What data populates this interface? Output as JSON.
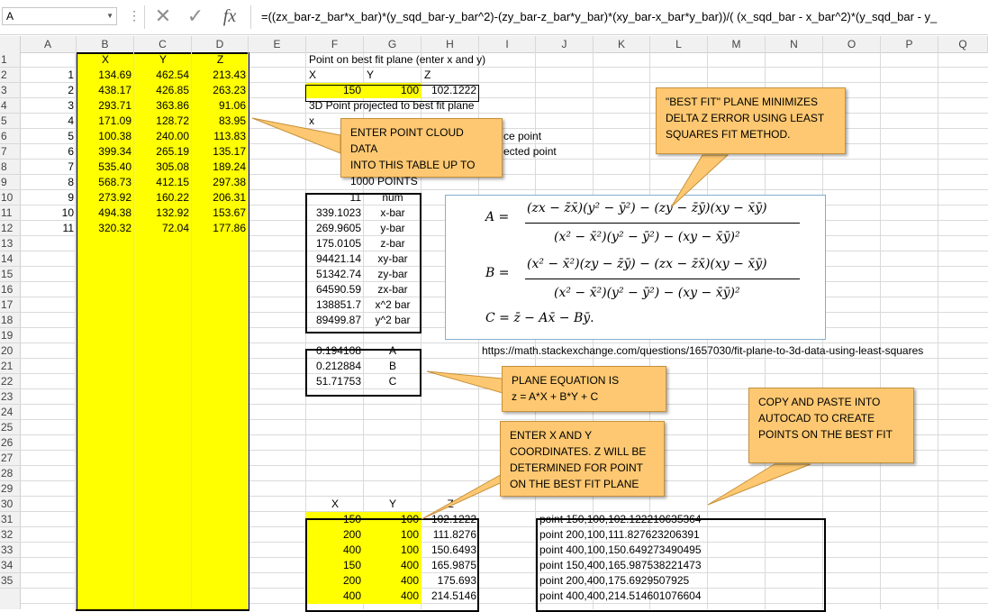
{
  "formula_bar": {
    "name_box": "A",
    "cancel_glyph": "✕",
    "enter_glyph": "✓",
    "fx_label": "fx",
    "formula": "=((zx_bar-z_bar*x_bar)*(y_sqd_bar-y_bar^2)-(zy_bar-z_bar*y_bar)*(xy_bar-x_bar*y_bar))/(    (x_sqd_bar - x_bar^2)*(y_sqd_bar - y_"
  },
  "columns": [
    "A",
    "B",
    "C",
    "D",
    "E",
    "F",
    "G",
    "H",
    "I",
    "J",
    "K",
    "L",
    "M",
    "N",
    "O",
    "P",
    "Q"
  ],
  "rows": [
    "1",
    "2",
    "3",
    "4",
    "5",
    "6",
    "7",
    "8",
    "9",
    "10",
    "11",
    "12",
    "13",
    "14",
    "15",
    "16",
    "17",
    "18",
    "19",
    "20",
    "21",
    "22",
    "23",
    "24",
    "25",
    "26",
    "27",
    "28",
    "29",
    "30",
    "31",
    "32",
    "33",
    "34",
    "35"
  ],
  "table": {
    "headers": [
      "X",
      "Y",
      "Z"
    ],
    "index": [
      "1",
      "2",
      "3",
      "4",
      "5",
      "6",
      "7",
      "8",
      "9",
      "10",
      "11"
    ],
    "x": [
      "134.69",
      "438.17",
      "293.71",
      "171.09",
      "100.38",
      "399.34",
      "535.40",
      "568.73",
      "273.92",
      "494.38",
      "320.32"
    ],
    "y": [
      "462.54",
      "426.85",
      "363.86",
      "128.72",
      "240.00",
      "265.19",
      "305.08",
      "412.15",
      "160.22",
      "132.92",
      "72.04"
    ],
    "z": [
      "213.43",
      "263.23",
      "91.06",
      "83.95",
      "113.83",
      "135.17",
      "189.24",
      "297.38",
      "206.31",
      "153.67",
      "177.86"
    ]
  },
  "point_section": {
    "title": "Point on best fit plane (enter x and y)",
    "x_label": "X",
    "y_label": "Y",
    "z_label": "Z",
    "x_val": "150",
    "y_val": "100",
    "z_val": "102.1222",
    "projected_title": "3D Point projected to best fit plane",
    "row5_partial": "x",
    "row6_partial": "ce point",
    "row7_partial": "ected  point"
  },
  "stats": [
    {
      "value": "11",
      "label": "num"
    },
    {
      "value": "339.1023",
      "label": "x-bar"
    },
    {
      "value": "269.9605",
      "label": "y-bar"
    },
    {
      "value": "175.0105",
      "label": "z-bar"
    },
    {
      "value": "94421.14",
      "label": "xy-bar"
    },
    {
      "value": "51342.74",
      "label": "zy-bar"
    },
    {
      "value": "64590.59",
      "label": "zx-bar"
    },
    {
      "value": "138851.7",
      "label": "x^2 bar"
    },
    {
      "value": "89499.87",
      "label": "y^2 bar"
    }
  ],
  "coeffs": [
    {
      "value": "0.194108",
      "label": "A"
    },
    {
      "value": "0.212884",
      "label": "B"
    },
    {
      "value": "51.71753",
      "label": "C"
    }
  ],
  "url": "https://math.stackexchange.com/questions/1657030/fit-plane-to-3d-data-using-least-squares",
  "bottom_headers": {
    "x": "X",
    "y": "Y",
    "z": "Z"
  },
  "bottom_points": [
    {
      "x": "150",
      "y": "100",
      "z": "102.1222",
      "cmd": "point 150,100,102.122210635364"
    },
    {
      "x": "200",
      "y": "100",
      "z": "111.8276",
      "cmd": "point 200,100,111.827623206391"
    },
    {
      "x": "400",
      "y": "100",
      "z": "150.6493",
      "cmd": "point 400,100,150.649273490495"
    },
    {
      "x": "150",
      "y": "400",
      "z": "165.9875",
      "cmd": "point 150,400,165.987538221473"
    },
    {
      "x": "200",
      "y": "400",
      "z": "175.693",
      "cmd": "point 200,400,175.6929507925"
    },
    {
      "x": "400",
      "y": "400",
      "z": "214.5146",
      "cmd": "point 400,400,214.514601076604"
    }
  ],
  "callouts": {
    "point_cloud": [
      "ENTER POINT CLOUD DATA",
      "INTO THIS TABLE UP TO",
      "1000 POINTS"
    ],
    "best_fit": [
      "\"BEST FIT\" PLANE MINIMIZES",
      "DELTA Z ERROR USING LEAST",
      "SQUARES FIT METHOD."
    ],
    "plane_eq": [
      "PLANE EQUATION IS",
      "z = A*X + B*Y + C"
    ],
    "enter_xy": [
      "ENTER X AND Y",
      "COORDINATES. Z WILL BE",
      "DETERMINED FOR POINT",
      "ON THE BEST FIT PLANE"
    ],
    "copy_paste": [
      "COPY AND PASTE INTO",
      "AUTOCAD  TO CREATE",
      "POINTS ON THE BEST FIT"
    ]
  },
  "equation_image": {
    "a_lhs": "A =",
    "a_num": "(zx − z̄x̄)(y² − ȳ²) − (zy − z̄ȳ)(xy − x̄ȳ)",
    "a_den": "(x² − x̄²)(y² − ȳ²) − (xy − x̄ȳ)²",
    "b_lhs": "B =",
    "b_num": "(x² − x̄²)(zy − z̄ȳ) − (zx − z̄x̄)(xy − x̄ȳ)",
    "b_den": "(x² − x̄²)(y² − ȳ²) − (xy − x̄ȳ)²",
    "c_line": "C = z̄ − Ax̄ − Bȳ."
  },
  "colors": {
    "yellow": "#ffff00",
    "callout": "#fdc871",
    "callout_border": "#c6913c",
    "eq_border": "#82b0cf"
  }
}
